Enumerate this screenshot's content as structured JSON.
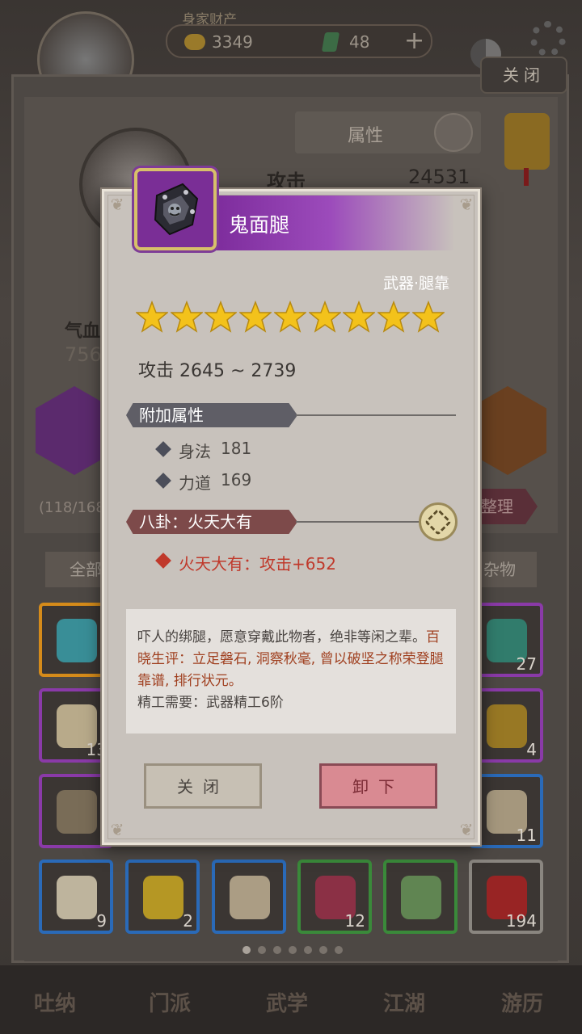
{
  "topbar": {
    "resources_title": "身家财产",
    "gold_value": "3349",
    "jade_value": "48",
    "plus_label": "+",
    "close_label": "关闭"
  },
  "character": {
    "attr_title": "属性",
    "attack_label": "攻击",
    "attack_value": "24531",
    "hp_label": "气血",
    "hp_value": "756",
    "bag_count": "(118/168",
    "sort_label": "整理"
  },
  "bag": {
    "tab_all": "全部",
    "tab_misc": "杂物",
    "slots": [
      {
        "count": "",
        "rarity_color": "#d58b1a",
        "icon_color": "#3aa5b0"
      },
      {
        "count": "27",
        "rarity_color": "#8a3aa8",
        "icon_color": "#2f8f7a"
      },
      {
        "count": "13",
        "rarity_color": "#8a3aa8",
        "icon_color": "#d8c8a0"
      },
      {
        "count": "4",
        "rarity_color": "#8a3aa8",
        "icon_color": "#b08a20"
      },
      {
        "count": "",
        "rarity_color": "#8a3aa8",
        "icon_color": "#8a7a60"
      },
      {
        "count": "11",
        "rarity_color": "#2a6ab8",
        "icon_color": "#c0b090"
      },
      {
        "count": "9",
        "rarity_color": "#2a6ab8",
        "icon_color": "#e0d4b8"
      },
      {
        "count": "2",
        "rarity_color": "#2a6ab8",
        "icon_color": "#d4b020"
      },
      {
        "count": "",
        "rarity_color": "#2a6ab8",
        "icon_color": "#c8b898"
      },
      {
        "count": "12",
        "rarity_color": "#3a8a3a",
        "icon_color": "#a0304a"
      },
      {
        "count": "",
        "rarity_color": "#3a8a3a",
        "icon_color": "#6a9a5a"
      },
      {
        "count": "194",
        "rarity_color": "#8a8680",
        "icon_color": "#b02020"
      }
    ],
    "page_count": 7,
    "current_page": 0
  },
  "bottom_nav": [
    "吐纳",
    "门派",
    "武学",
    "江湖",
    "游历"
  ],
  "dialog": {
    "item_name": "鬼面腿",
    "item_icon": "leg-guard-icon",
    "category": "武器·腿靠",
    "stars": 9,
    "attack_text": "攻击  2645 ~ 2739",
    "extra_section_title": "附加属性",
    "extra_attrs": [
      {
        "name": "身法",
        "value": "181"
      },
      {
        "name": "力道",
        "value": "169"
      }
    ],
    "bagua_section_title": "八卦：火天大有",
    "bagua_effect": "火天大有：攻击+652",
    "description_plain": "吓人的绑腿，愿意穿戴此物者，绝非等闲之辈。",
    "description_red": "百晓生评：立足磐石, 洞察秋毫, 曾以破坚之称荣登腿靠谱, 排行状元。",
    "refine_requirement": "精工需要：武器精工6阶",
    "close_button": "关闭",
    "unequip_button": "卸下"
  },
  "colors": {
    "title_purple": "#7b2a9a",
    "star_gold": "#f3c21b",
    "bagua_red": "#c0392b",
    "unequip_pink": "#d98a92"
  }
}
